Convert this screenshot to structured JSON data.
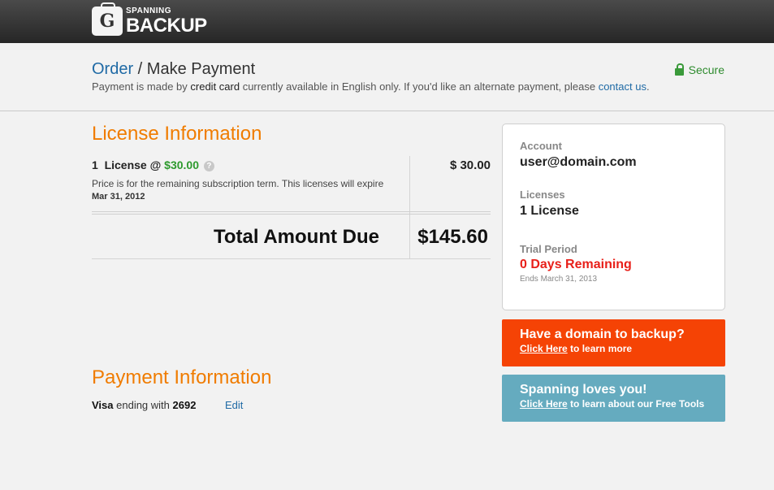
{
  "brand": {
    "top": "SPANNING",
    "main": "BACKUP",
    "badge_letter": "G"
  },
  "header": {
    "crumb_link": "Order",
    "crumb_sep": " / ",
    "crumb_current": "Make Payment",
    "note_pre": "Payment is made by ",
    "note_strong": "credit card",
    "note_mid": " currently available in English only. If you'd like an alternate payment, please ",
    "note_link": "contact us",
    "note_end": ".",
    "secure": "Secure"
  },
  "license": {
    "title": "License Information",
    "qty": "1",
    "label": "License @",
    "unit_price": "$30.00",
    "help_icon": "question-icon",
    "line_amount": "$ 30.00",
    "note": "Price is for the remaining subscription term. This licenses will expire",
    "expire_date": "Mar 31, 2012",
    "total_label": "Total Amount Due",
    "total_amount": "$145.60"
  },
  "payment": {
    "title": "Payment Information",
    "card_brand": "Visa",
    "card_mid": " ending with ",
    "card_last4": "2692",
    "edit": "Edit"
  },
  "account": {
    "account_label": "Account",
    "account_value": "user@domain.com",
    "licenses_label": "Licenses",
    "licenses_value": "1 License",
    "trial_label": "Trial Period",
    "trial_value": "0 Days Remaining",
    "trial_ends": "Ends March 31, 2013"
  },
  "promos": [
    {
      "headline": "Have a domain to backup?",
      "link": "Click Here",
      "rest": " to learn more",
      "color": "#f54305"
    },
    {
      "headline": "Spanning loves you!",
      "link": "Click Here",
      "rest": " to learn about our Free Tools",
      "color": "#65abbf"
    }
  ],
  "colors": {
    "accent_orange": "#f07c00",
    "link_blue": "#1f6aa5",
    "price_green": "#2e9a2e",
    "alert_red": "#e8201a"
  }
}
